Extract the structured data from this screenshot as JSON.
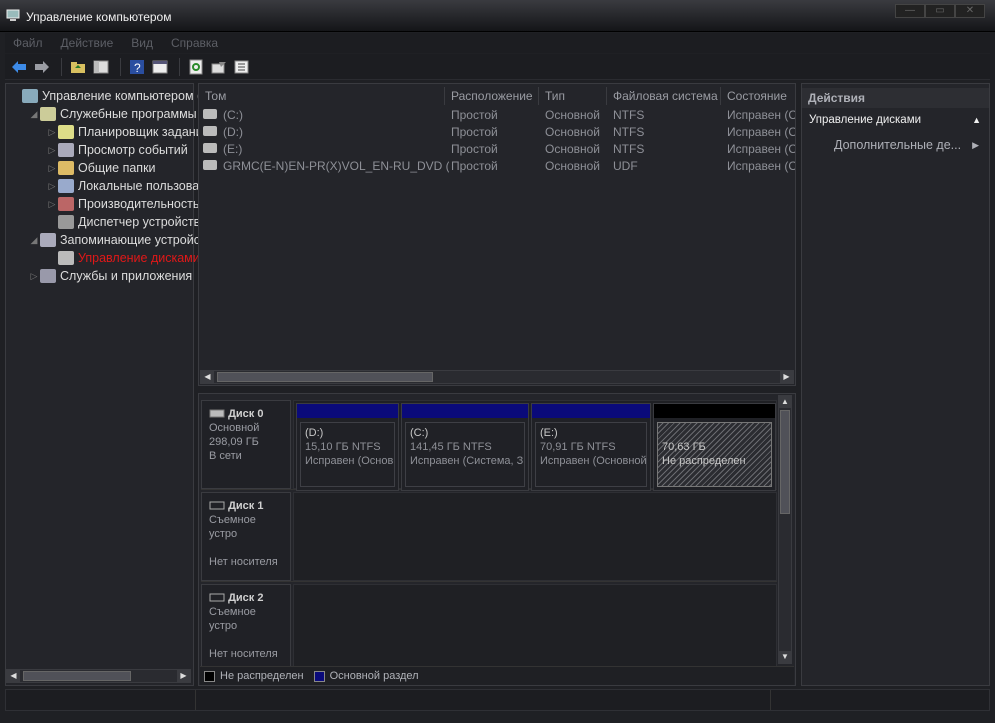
{
  "window": {
    "title": "Управление компьютером"
  },
  "menu": [
    "Файл",
    "Действие",
    "Вид",
    "Справка"
  ],
  "tree": [
    {
      "label": "Управление компьютером (",
      "level": 0,
      "arrow": ""
    },
    {
      "label": "Служебные программы",
      "level": 1,
      "arrow": "◢"
    },
    {
      "label": "Планировщик задани",
      "level": 2,
      "arrow": "▷"
    },
    {
      "label": "Просмотр событий",
      "level": 2,
      "arrow": "▷"
    },
    {
      "label": "Общие папки",
      "level": 2,
      "arrow": "▷"
    },
    {
      "label": "Локальные пользова",
      "level": 2,
      "arrow": "▷"
    },
    {
      "label": "Производительность",
      "level": 2,
      "arrow": "▷"
    },
    {
      "label": "Диспетчер устройств",
      "level": 2,
      "arrow": ""
    },
    {
      "label": "Запоминающие устройс",
      "level": 1,
      "arrow": "◢"
    },
    {
      "label": "Управление дисками",
      "level": 2,
      "arrow": "",
      "selected": true
    },
    {
      "label": "Службы и приложения",
      "level": 1,
      "arrow": "▷"
    }
  ],
  "volumes": {
    "columns": [
      "Том",
      "Расположение",
      "Тип",
      "Файловая система",
      "Состояние"
    ],
    "rows": [
      [
        "(C:)",
        "Простой",
        "Основной",
        "NTFS",
        "Исправен (С"
      ],
      [
        "(D:)",
        "Простой",
        "Основной",
        "NTFS",
        "Исправен (О"
      ],
      [
        "(E:)",
        "Простой",
        "Основной",
        "NTFS",
        "Исправен (О"
      ],
      [
        "GRMC(E-N)EN-PR(X)VOL_EN-RU_DVD (F:)",
        "Простой",
        "Основной",
        "UDF",
        "Исправен (О"
      ]
    ]
  },
  "disks": [
    {
      "name": "Диск 0",
      "type": "Основной",
      "size": "298,09 ГБ",
      "status": "В сети",
      "partitions": [
        {
          "name": "(D:)",
          "size": "15,10 ГБ NTFS",
          "state": "Исправен (Основ"
        },
        {
          "name": "(C:)",
          "size": "141,45 ГБ NTFS",
          "state": "Исправен (Система, З"
        },
        {
          "name": "(E:)",
          "size": "70,91 ГБ NTFS",
          "state": "Исправен (Основной"
        },
        {
          "name": "",
          "size": "70,63 ГБ",
          "state": "Не распределен"
        }
      ]
    },
    {
      "name": "Диск 1",
      "type": "Съемное устро",
      "size": "",
      "status": "Нет носителя"
    },
    {
      "name": "Диск 2",
      "type": "Съемное устро",
      "size": "",
      "status": "Нет носителя"
    }
  ],
  "legend": {
    "unallocated": "Не распределен",
    "primary": "Основной раздел"
  },
  "actions": {
    "header": "Действия",
    "section": "Управление дисками",
    "item": "Дополнительные де..."
  },
  "colors": {
    "primary_partition": "#0a0a7a",
    "selected_tree": "#e01818"
  }
}
